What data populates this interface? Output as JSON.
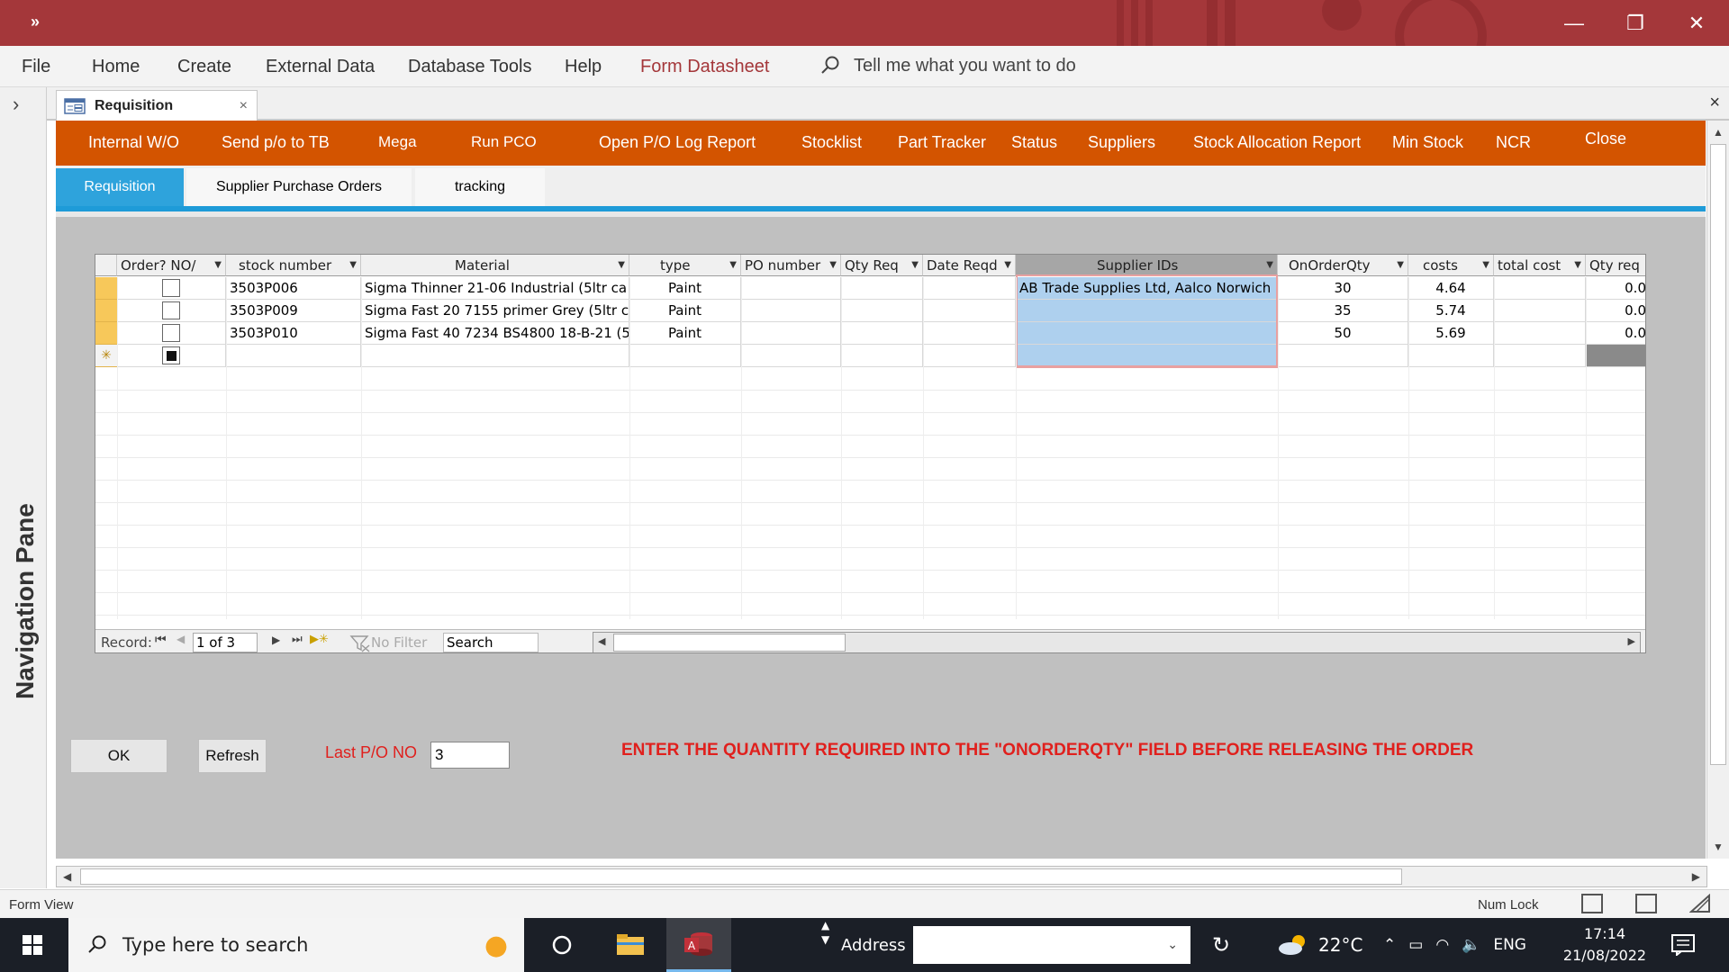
{
  "window": {
    "qat_symbol": "»",
    "controls": {
      "minimize": "—",
      "restore": "❐",
      "close": "✕"
    }
  },
  "ribbon": {
    "items": [
      "File",
      "Home",
      "Create",
      "External Data",
      "Database Tools",
      "Help",
      "Form Datasheet"
    ],
    "active": "Form Datasheet",
    "tell_me": "Tell me what you want to do"
  },
  "nav_pane": {
    "label": "Navigation Pane",
    "toggle": "›"
  },
  "document_tab": {
    "title": "Requisition",
    "close": "×",
    "pane_close": "×"
  },
  "toolbar": {
    "buttons": [
      "Internal W/O",
      "Send p/o to TB",
      "Mega",
      "Run PCO",
      "Open P/O Log Report",
      "Stocklist",
      "Part Tracker",
      "Status",
      "Suppliers",
      "Stock Allocation Report",
      "Min Stock",
      "NCR",
      "Close"
    ],
    "color": "#d35400"
  },
  "form_tabs": {
    "items": [
      "Requisition",
      "Supplier Purchase Orders",
      "tracking"
    ],
    "active": "Requisition",
    "active_color": "#2ea3dc"
  },
  "datasheet": {
    "columns": [
      "Order? NO/",
      "stock number",
      "Material",
      "type",
      "PO number",
      "Qty Req",
      "Date Reqd",
      "Supplier IDs",
      "OnOrderQty",
      "costs",
      "total cost",
      "Qty req"
    ],
    "selected_column": "Supplier IDs",
    "rows": [
      {
        "order": false,
        "stock_number": "3503P006",
        "material": "Sigma Thinner 21-06 Industrial (5ltr ca",
        "type": "Paint",
        "po_number": "",
        "qty_req": "",
        "date_reqd": "",
        "supplier_ids": "AB Trade Supplies Ltd, Aalco Norwich",
        "on_order_qty": "30",
        "costs": "4.64",
        "total_cost": "",
        "qty_req2": "0.0"
      },
      {
        "order": false,
        "stock_number": "3503P009",
        "material": "Sigma Fast 20 7155 primer Grey (5ltr c",
        "type": "Paint",
        "po_number": "",
        "qty_req": "",
        "date_reqd": "",
        "supplier_ids": "",
        "on_order_qty": "35",
        "costs": "5.74",
        "total_cost": "",
        "qty_req2": "0.0"
      },
      {
        "order": false,
        "stock_number": "3503P010",
        "material": "Sigma Fast 40 7234 BS4800 18-B-21 (5",
        "type": "Paint",
        "po_number": "",
        "qty_req": "",
        "date_reqd": "",
        "supplier_ids": "",
        "on_order_qty": "50",
        "costs": "5.69",
        "total_cost": "",
        "qty_req2": "0.0"
      }
    ],
    "new_row_symbol": "✳",
    "navigator": {
      "record_label": "Record:",
      "position": "1 of 3",
      "filter": "No Filter",
      "search": "Search"
    }
  },
  "footer": {
    "ok": "OK",
    "refresh": "Refresh",
    "last_po_label": "Last P/O NO",
    "last_po_value": "3",
    "warning": "ENTER THE QUANTITY REQUIRED INTO THE \"ONORDERQTY\" FIELD BEFORE RELEASING THE ORDER"
  },
  "status_bar": {
    "view": "Form View",
    "num_lock": "Num Lock"
  },
  "taskbar": {
    "search_placeholder": "Type here to search",
    "address_label": "Address",
    "weather": "22°C",
    "language": "ENG",
    "time": "17:14",
    "date": "21/08/2022"
  }
}
